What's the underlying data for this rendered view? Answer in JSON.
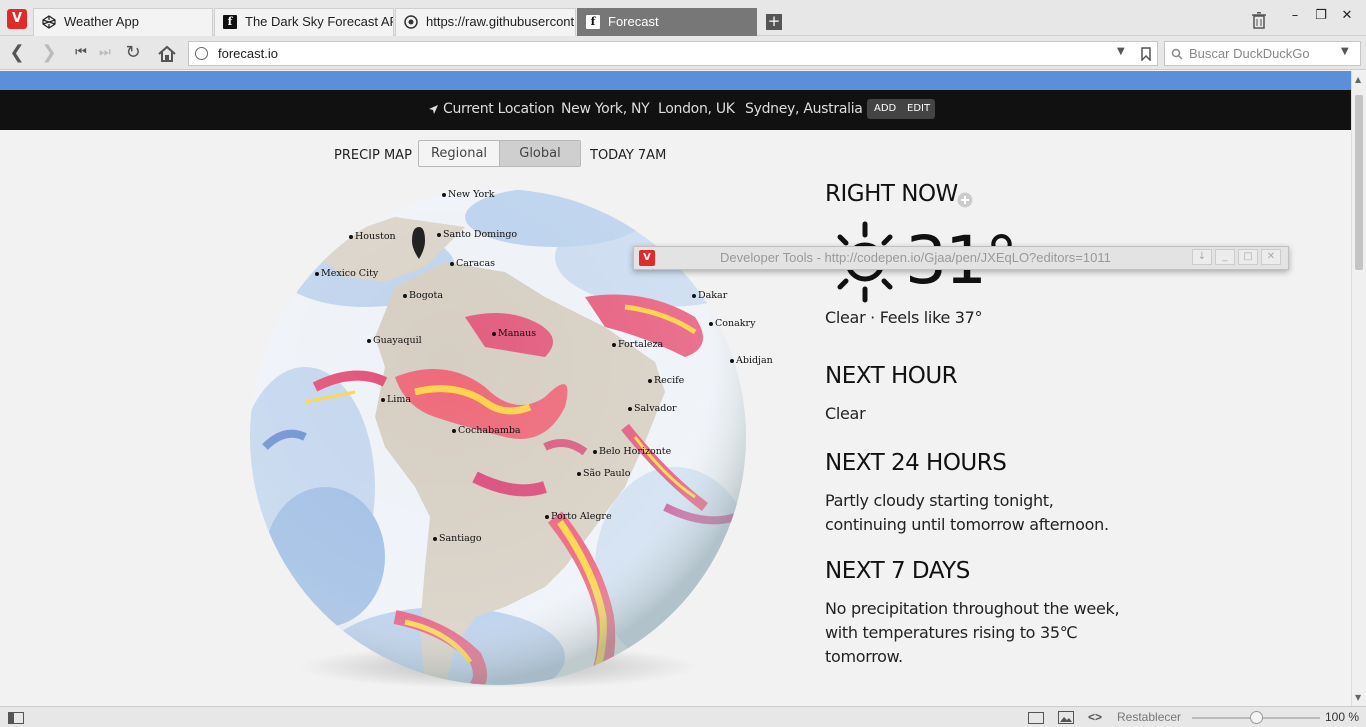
{
  "browser": {
    "tabs": [
      {
        "label": "Weather App",
        "icon": "codepen-icon"
      },
      {
        "label": "The Dark Sky Forecast AP",
        "icon": "forecast-icon"
      },
      {
        "label": "https://raw.githubusercont",
        "icon": "github-icon"
      },
      {
        "label": "Forecast",
        "icon": "forecast-icon"
      }
    ],
    "url": "forecast.io",
    "search_placeholder": "Buscar DuckDuckGo"
  },
  "nav": {
    "locations": [
      "Current Location",
      "New York, NY",
      "London, UK",
      "Sydney, Australia"
    ],
    "add": "ADD",
    "edit": "EDIT"
  },
  "map": {
    "label": "PRECIP MAP",
    "regional": "Regional",
    "global": "Global",
    "time": "TODAY 7AM",
    "cities": [
      "New York",
      "Houston",
      "Santo Domingo",
      "Caracas",
      "Mexico City",
      "Bogota",
      "Dakar",
      "Conakry",
      "Guayaquil",
      "Manaus",
      "Fortaleza",
      "Abidjan",
      "Recife",
      "Lima",
      "Salvador",
      "Cochabamba",
      "Belo Horizonte",
      "São Paulo",
      "Porto Alegre",
      "Santiago"
    ]
  },
  "weather": {
    "right_now": "RIGHT NOW",
    "temp": "31°",
    "summary": "Clear · Feels like 37°",
    "next_hour_title": "NEXT HOUR",
    "next_hour_text": "Clear",
    "next_24_title": "NEXT 24 HOURS",
    "next_24_line1": "Partly cloudy starting tonight,",
    "next_24_line2": "continuing until tomorrow afternoon.",
    "next_7_title": "NEXT 7 DAYS",
    "next_7_line1": "No precipitation throughout the week,",
    "next_7_line2": "with temperatures rising to 35℃",
    "next_7_line3": "tomorrow."
  },
  "devtools": {
    "title": "Developer Tools - http://codepen.io/Gjaa/pen/JXEqLO?editors=1011"
  },
  "status": {
    "reset": "Restablecer",
    "zoom": "100 %",
    "zoom_level": 0.5
  }
}
